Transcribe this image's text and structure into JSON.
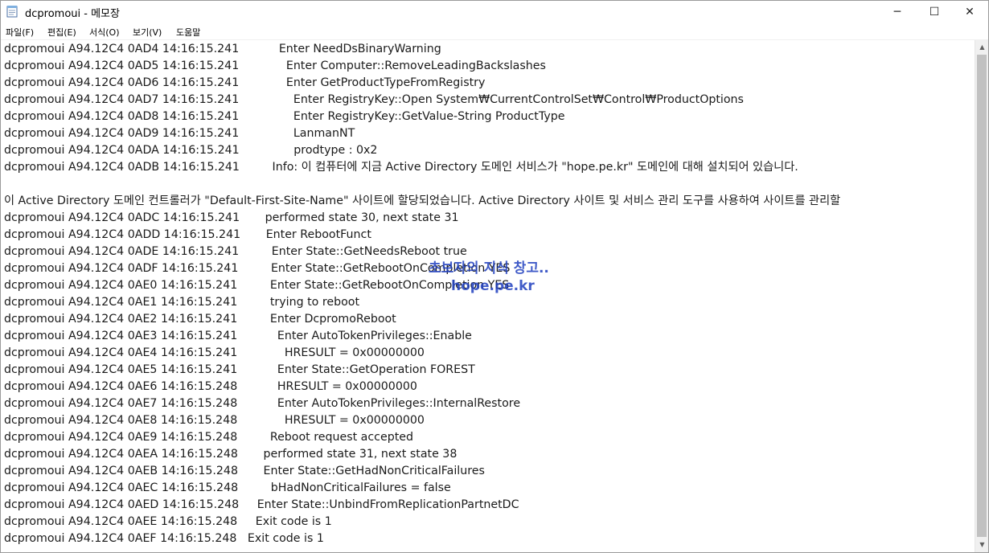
{
  "window": {
    "title": "dcpromoui - 메모장",
    "minimize_glyph": "─",
    "maximize_glyph": "☐",
    "close_glyph": "✕"
  },
  "menu": [
    {
      "label": "파일(F)"
    },
    {
      "label": "편집(E)"
    },
    {
      "label": "서식(O)"
    },
    {
      "label": "보기(V)"
    },
    {
      "label": "도움말"
    }
  ],
  "lines": [
    "dcpromoui A94.12C4 0AD4 14:16:15.241           Enter NeedDsBinaryWarning",
    "dcpromoui A94.12C4 0AD5 14:16:15.241             Enter Computer::RemoveLeadingBackslashes",
    "dcpromoui A94.12C4 0AD6 14:16:15.241             Enter GetProductTypeFromRegistry",
    "dcpromoui A94.12C4 0AD7 14:16:15.241               Enter RegistryKey::Open System₩CurrentControlSet₩Control₩ProductOptions",
    "dcpromoui A94.12C4 0AD8 14:16:15.241               Enter RegistryKey::GetValue-String ProductType",
    "dcpromoui A94.12C4 0AD9 14:16:15.241               LanmanNT",
    "dcpromoui A94.12C4 0ADA 14:16:15.241               prodtype : 0x2",
    "dcpromoui A94.12C4 0ADB 14:16:15.241         Info: 이 컴퓨터에 지금 Active Directory 도메인 서비스가 \"hope.pe.kr\" 도메인에 대해 설치되어 있습니다.",
    "",
    "이 Active Directory 도메인 컨트롤러가 \"Default-First-Site-Name\" 사이트에 할당되었습니다. Active Directory 사이트 및 서비스 관리 도구를 사용하여 사이트를 관리할",
    "dcpromoui A94.12C4 0ADC 14:16:15.241       performed state 30, next state 31",
    "dcpromoui A94.12C4 0ADD 14:16:15.241       Enter RebootFunct",
    "dcpromoui A94.12C4 0ADE 14:16:15.241         Enter State::GetNeedsReboot true",
    "dcpromoui A94.12C4 0ADF 14:16:15.241         Enter State::GetRebootOnCompletion YES",
    "dcpromoui A94.12C4 0AE0 14:16:15.241         Enter State::GetRebootOnCompletion YES",
    "dcpromoui A94.12C4 0AE1 14:16:15.241         trying to reboot",
    "dcpromoui A94.12C4 0AE2 14:16:15.241         Enter DcpromoReboot",
    "dcpromoui A94.12C4 0AE3 14:16:15.241           Enter AutoTokenPrivileges::Enable",
    "dcpromoui A94.12C4 0AE4 14:16:15.241             HRESULT = 0x00000000",
    "dcpromoui A94.12C4 0AE5 14:16:15.241           Enter State::GetOperation FOREST",
    "dcpromoui A94.12C4 0AE6 14:16:15.248           HRESULT = 0x00000000",
    "dcpromoui A94.12C4 0AE7 14:16:15.248           Enter AutoTokenPrivileges::InternalRestore",
    "dcpromoui A94.12C4 0AE8 14:16:15.248             HRESULT = 0x00000000",
    "dcpromoui A94.12C4 0AE9 14:16:15.248         Reboot request accepted",
    "dcpromoui A94.12C4 0AEA 14:16:15.248       performed state 31, next state 38",
    "dcpromoui A94.12C4 0AEB 14:16:15.248       Enter State::GetHadNonCriticalFailures",
    "dcpromoui A94.12C4 0AEC 14:16:15.248         bHadNonCriticalFailures = false",
    "dcpromoui A94.12C4 0AED 14:16:15.248     Enter State::UnbindFromReplicationPartnetDC",
    "dcpromoui A94.12C4 0AEE 14:16:15.248     Exit code is 1",
    "dcpromoui A94.12C4 0AEF 14:16:15.248   Exit code is 1"
  ],
  "watermark": {
    "line1": "초보자의 지식 창고..",
    "line2": "hope.pe.kr"
  }
}
